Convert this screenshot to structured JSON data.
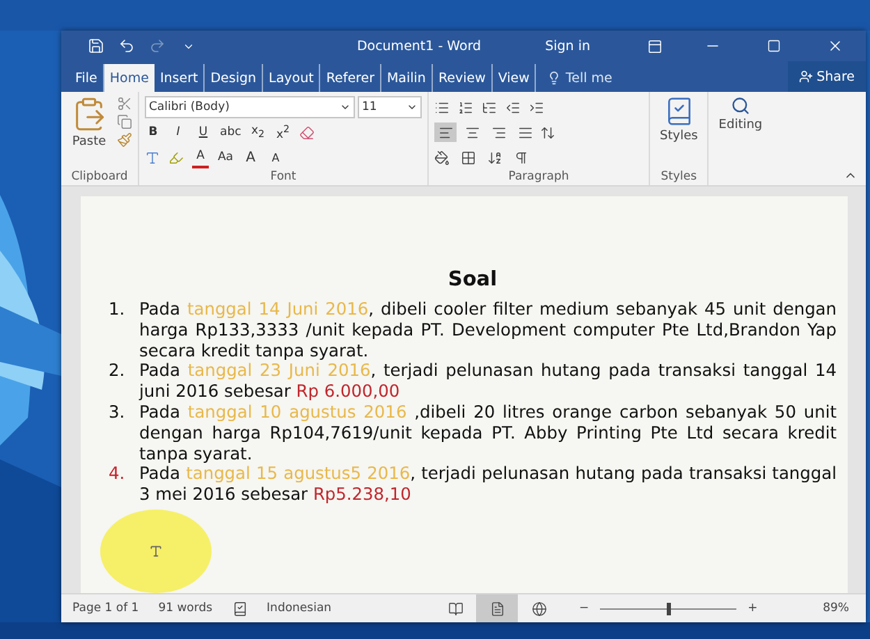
{
  "window": {
    "title": "Document1 - Word",
    "sign_in": "Sign in",
    "redo_disabled": true
  },
  "tabs": [
    {
      "label": "File",
      "selected": false
    },
    {
      "label": "Home",
      "selected": true
    },
    {
      "label": "Insert",
      "selected": false
    },
    {
      "label": "Design",
      "selected": false
    },
    {
      "label": "Layout",
      "selected": false
    },
    {
      "label": "Referer",
      "selected": false
    },
    {
      "label": "Mailin",
      "selected": false
    },
    {
      "label": "Review",
      "selected": false
    },
    {
      "label": "View",
      "selected": false
    }
  ],
  "tell_me": "Tell me",
  "share": "Share",
  "ribbon": {
    "clipboard": {
      "paste": "Paste",
      "label": "Clipboard"
    },
    "font": {
      "name": "Calibri (Body)",
      "size": "11",
      "format_buttons": [
        "B",
        "I",
        "U",
        "abc",
        "x$_{2}$",
        "x$^{2}$"
      ],
      "case": "Aa",
      "grow": "A",
      "shrink": "A",
      "font_color": "A",
      "label": "Font"
    },
    "paragraph": {
      "alignments": [
        {
          "kind": "left",
          "selected": true
        },
        {
          "kind": "center",
          "selected": false
        },
        {
          "kind": "right",
          "selected": false
        },
        {
          "kind": "justify",
          "selected": false
        }
      ],
      "label": "Paragraph"
    },
    "styles": {
      "button": "Styles",
      "label": "Styles"
    },
    "editing": {
      "button": "Editing"
    }
  },
  "document": {
    "title": "Soal",
    "items": [
      {
        "number": "1.",
        "flagged": false,
        "segments": [
          {
            "kind": "plain",
            "text": "Pada "
          },
          {
            "kind": "date",
            "text": "tanggal 14 Juni 2016"
          },
          {
            "kind": "plain",
            "text": ", dibeli cooler filter medium sebanyak 45 unit dengan harga Rp133,3333 /unit kepada PT. Development computer Pte Ltd,Brandon Yap secara kredit tanpa syarat."
          }
        ]
      },
      {
        "number": "2.",
        "flagged": false,
        "segments": [
          {
            "kind": "plain",
            "text": "Pada "
          },
          {
            "kind": "date",
            "text": "tanggal 23 Juni 2016"
          },
          {
            "kind": "plain",
            "text": ", terjadi pelunasan hutang pada transaksi tanggal 14 juni 2016 sebesar "
          },
          {
            "kind": "amount",
            "text": "Rp 6.000,00"
          }
        ]
      },
      {
        "number": "3.",
        "flagged": false,
        "segments": [
          {
            "kind": "plain",
            "text": "Pada "
          },
          {
            "kind": "date",
            "text": "tanggal 10 agustus 2016"
          },
          {
            "kind": "plain",
            "text": " ,dibeli 20 litres orange carbon sebanyak 50 unit dengan harga Rp104,7619/unit  kepada PT. Abby Printing Pte Ltd secara kredit tanpa syarat."
          }
        ]
      },
      {
        "number": "4.",
        "flagged": true,
        "segments": [
          {
            "kind": "plain",
            "text": "Pada "
          },
          {
            "kind": "date",
            "text": "tanggal 15 agustus5 2016"
          },
          {
            "kind": "plain",
            "text": ", terjadi pelunasan hutang pada transaksi tanggal 3 mei 2016 sebesar "
          },
          {
            "kind": "amount",
            "text": "Rp5.238,10"
          }
        ]
      }
    ]
  },
  "status_bar": {
    "page": "Page 1 of 1",
    "words": "91 words",
    "language": "Indonesian",
    "views": [
      {
        "kind": "read",
        "selected": false
      },
      {
        "kind": "print",
        "selected": true
      },
      {
        "kind": "web",
        "selected": false
      }
    ],
    "zoom_out": "−",
    "zoom_in": "+",
    "zoom": {
      "level": 0.5
    },
    "zoom_label": "89%"
  }
}
